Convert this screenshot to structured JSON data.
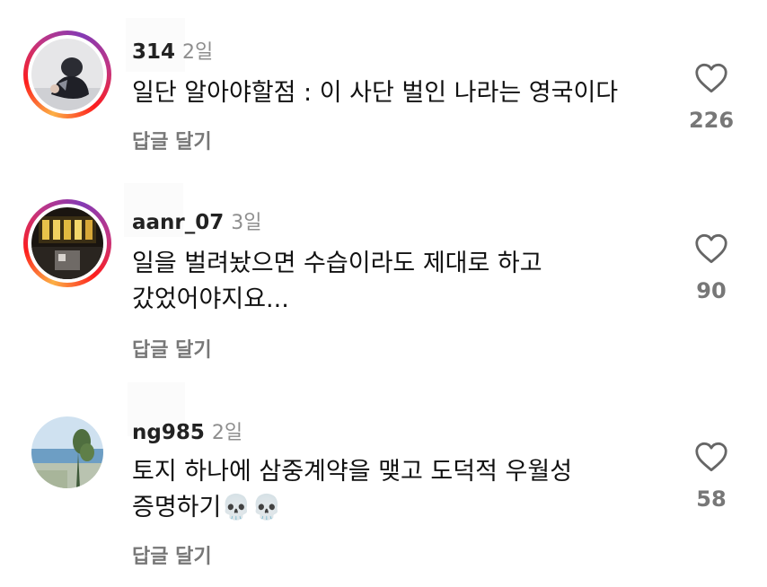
{
  "comments": [
    {
      "username": "314",
      "time": "2일",
      "text": "일단 알아야할점 : 이 사단 벌인 나라는 영국이다",
      "reply_label": "답글 달기",
      "likes": "226"
    },
    {
      "username": "aanr_07",
      "time": "3일",
      "text": "일을 벌려놨으면 수습이라도 제대로 하고\n갔었어야지요...",
      "reply_label": "답글 달기",
      "likes": "90"
    },
    {
      "username": "ng985",
      "time": "2일",
      "text": "토지 하나에 삼중계약을 맺고 도덕적 우월성\n증명하기💀💀",
      "reply_label": "답글 달기",
      "likes": "58"
    }
  ],
  "icons": {
    "like": "heart-outline-icon",
    "story_ring": "story-ring"
  },
  "colors": {
    "like_count": "#777777",
    "time": "#8e8e8e",
    "reply": "#777777"
  }
}
